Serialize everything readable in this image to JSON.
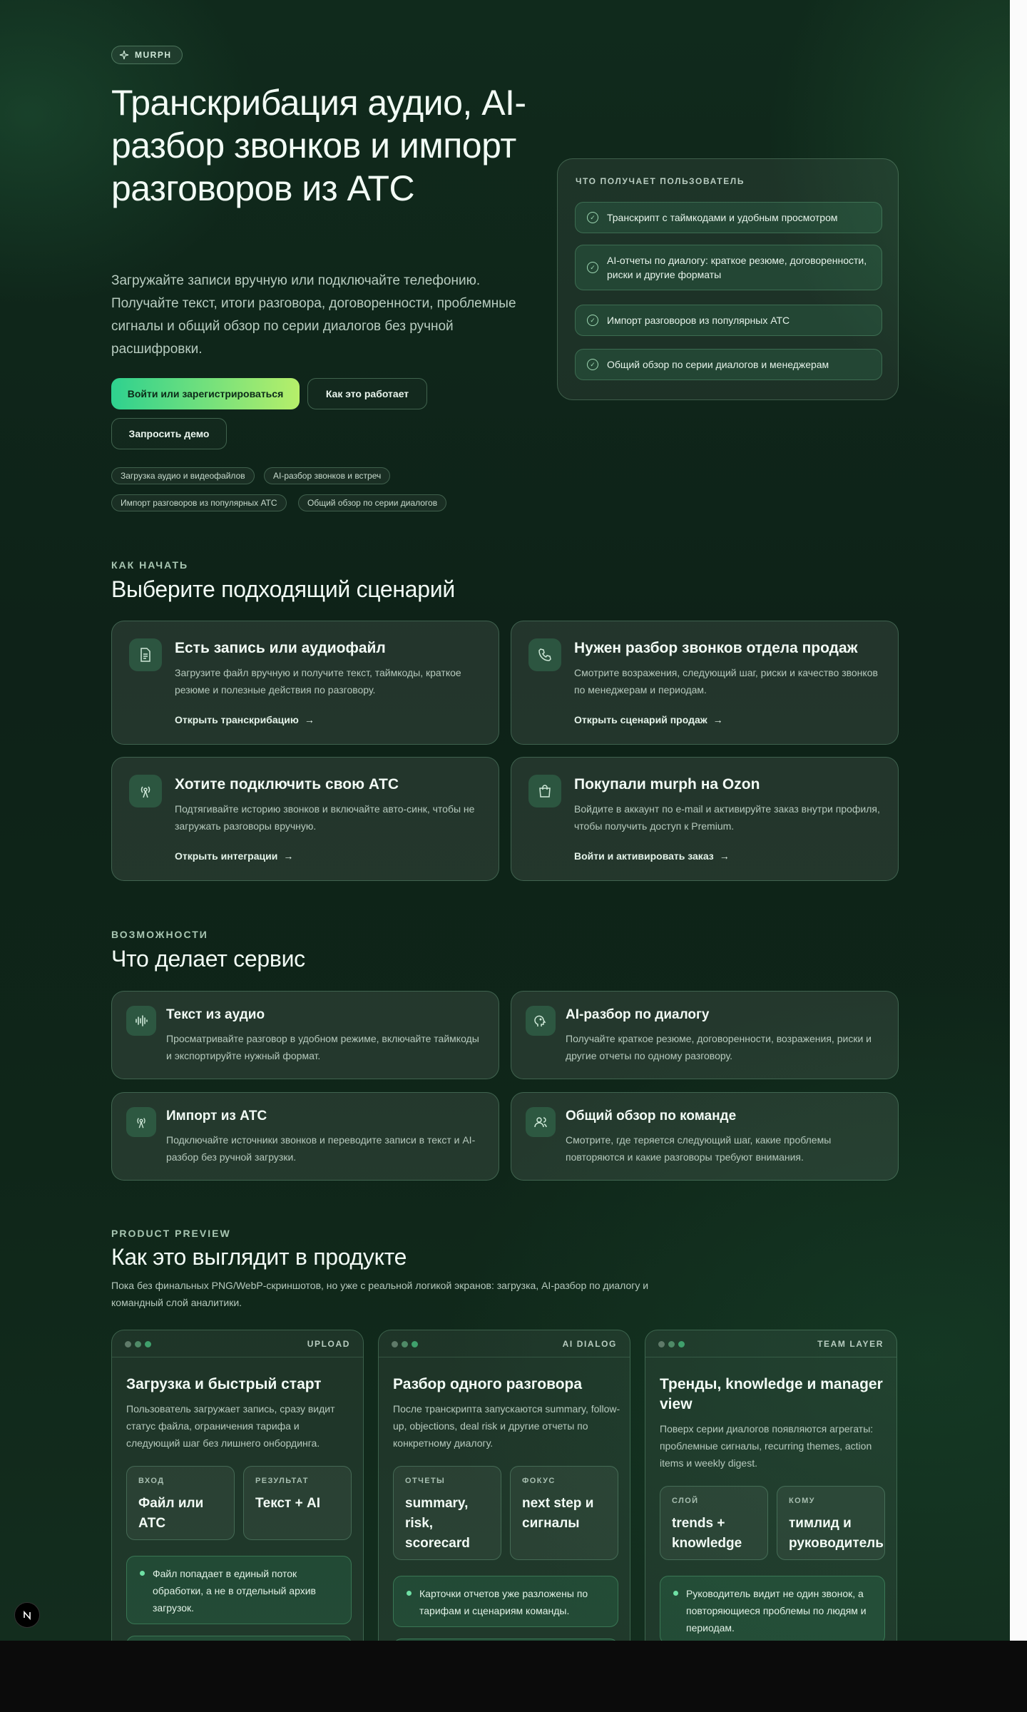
{
  "badge": {
    "label": "MURPH",
    "icon": "sparkle-icon"
  },
  "hero": {
    "title": "Транскрибация аудио, AI-разбор звонков и импорт разговоров из АТС",
    "description": "Загружайте записи вручную или подключайте телефонию. Получайте текст, итоги разговора, договоренности, проблемные сигналы и общий обзор по серии диалогов без ручной расшифровки.",
    "primary_button": "Войти или зарегистрироваться",
    "how_button": "Как это работает",
    "demo_button": "Запросить демо",
    "chips": [
      "Загрузка аудио и видеофайлов",
      "AI-разбор звонков и встреч",
      "Импорт разговоров из популярных АТС",
      "Общий обзор по серии диалогов"
    ]
  },
  "panel": {
    "title": "ЧТО ПОЛУЧАЕТ ПОЛЬЗОВАТЕЛЬ",
    "items": [
      "Транскрипт с таймкодами и удобным просмотром",
      "AI-отчеты по диалогу: краткое резюме, договоренности, риски и другие форматы",
      "Импорт разговоров из популярных АТС",
      "Общий обзор по серии диалогов и менеджерам"
    ]
  },
  "start": {
    "eyebrow": "КАК НАЧАТЬ",
    "title": "Выберите подходящий сценарий",
    "cards": [
      {
        "icon": "document-icon",
        "title": "Есть запись или аудиофайл",
        "desc": "Загрузите файл вручную и получите текст, таймкоды, краткое резюме и полезные действия по разговору.",
        "link": "Открыть транскрибацию"
      },
      {
        "icon": "phone-icon",
        "title": "Нужен разбор звонков отдела продаж",
        "desc": "Смотрите возражения, следующий шаг, риски и качество звонков по менеджерам и периодам.",
        "link": "Открыть сценарий продаж"
      },
      {
        "icon": "antenna-icon",
        "title": "Хотите подключить свою АТС",
        "desc": "Подтягивайте историю звонков и включайте авто-синк, чтобы не загружать разговоры вручную.",
        "link": "Открыть интеграции"
      },
      {
        "icon": "shopping-bag-icon",
        "title": "Покупали murph на Ozon",
        "desc": "Войдите в аккаунт по e-mail и активируйте заказ внутри профиля, чтобы получить доступ к Premium.",
        "link": "Войти и активировать заказ"
      }
    ]
  },
  "features": {
    "eyebrow": "ВОЗМОЖНОСТИ",
    "title": "Что делает сервис",
    "cards": [
      {
        "icon": "waveform-icon",
        "title": "Текст из аудио",
        "desc": "Просматривайте разговор в удобном режиме, включайте таймкоды и экспортируйте нужный формат."
      },
      {
        "icon": "ai-head-icon",
        "title": "AI-разбор по диалогу",
        "desc": "Получайте краткое резюме, договоренности, возражения, риски и другие отчеты по одному разговору."
      },
      {
        "icon": "antenna-icon",
        "title": "Импорт из АТС",
        "desc": "Подключайте источники звонков и переводите записи в текст и AI-разбор без ручной загрузки."
      },
      {
        "icon": "team-icon",
        "title": "Общий обзор по команде",
        "desc": "Смотрите, где теряется следующий шаг, какие проблемы повторяются и какие разговоры требуют внимания."
      }
    ]
  },
  "preview": {
    "eyebrow": "PRODUCT PREVIEW",
    "title": "Как это выглядит в продукте",
    "subtitle": "Пока без финальных PNG/WebP-скриншотов, но уже с реальной логикой экранов: загрузка, AI-разбор по диалогу и командный слой аналитики.",
    "cards": [
      {
        "tag": "UPLOAD",
        "title": "Загрузка и быстрый старт",
        "desc": "Пользователь загружает запись, сразу видит статус файла, ограничения тарифа и следующий шаг без лишнего онбординга.",
        "mini": [
          {
            "label": "ВХОД",
            "value": "Файл или АТС"
          },
          {
            "label": "РЕЗУЛЬТАТ",
            "value": "Текст + AI"
          }
        ],
        "note": "Файл попадает в единый поток обработки, а не в отдельный архив загрузок."
      },
      {
        "tag": "AI DIALOG",
        "title": "Разбор одного разговора",
        "desc": "После транскрипта запускаются summary, follow-up, objections, deal risk и другие отчеты по конкретному диалогу.",
        "mini": [
          {
            "label": "ОТЧЕТЫ",
            "value": "summary, risk, scorecard"
          },
          {
            "label": "ФОКУС",
            "value": "next step и сигналы"
          }
        ],
        "note": "Карточки отчетов уже разложены по тарифам и сценариям команды."
      },
      {
        "tag": "TEAM LAYER",
        "title": "Тренды, knowledge и manager view",
        "desc": "Поверх серии диалогов появляются агрегаты: проблемные сигналы, recurring themes, action items и weekly digest.",
        "mini": [
          {
            "label": "СЛОЙ",
            "value": "trends + knowledge"
          },
          {
            "label": "КОМУ",
            "value": "тимлид и руководитель"
          }
        ],
        "note": "Руководитель видит не один звонок, а повторяющиеся проблемы по людям и периодам."
      }
    ]
  },
  "colors": {
    "accent_start": "#2ed18f",
    "accent_end": "#b6ef6a",
    "background": "#0f2619"
  }
}
